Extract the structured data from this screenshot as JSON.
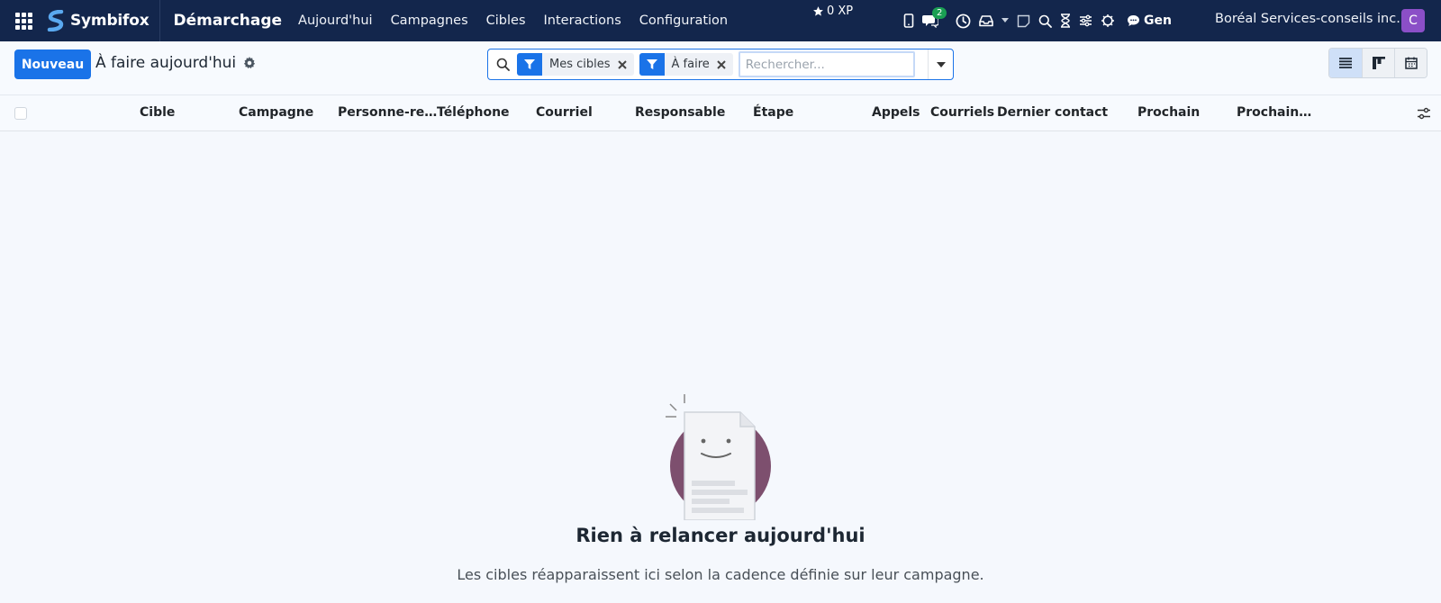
{
  "navbar": {
    "brand": "Symbifox",
    "app_title": "Démarchage",
    "menu": [
      {
        "label": "Aujourd'hui"
      },
      {
        "label": "Campagnes"
      },
      {
        "label": "Cibles"
      },
      {
        "label": "Interactions"
      },
      {
        "label": "Configuration"
      }
    ],
    "xp": "0 XP",
    "chat_badge": "2",
    "gen_label": "Gen",
    "company": "Boréal Services-conseils inc.",
    "avatar_letter": "C",
    "colors": {
      "background": "#13264c",
      "avatar": "#8b4fc7",
      "badge": "#1a9f53"
    }
  },
  "control": {
    "new_label": "Nouveau",
    "view_title": "À faire aujourd'hui",
    "facets": [
      {
        "label": "Mes cibles"
      },
      {
        "label": "À faire"
      }
    ],
    "search_placeholder": "Rechercher...",
    "accent": "#1a73e8"
  },
  "table": {
    "columns": [
      "Cible",
      "Campagne",
      "Personne-re…",
      "Téléphone",
      "Courriel",
      "Responsable",
      "Étape",
      "Appels",
      "Courriels",
      "Dernier contact",
      "Prochain",
      "Prochain…"
    ]
  },
  "empty_state": {
    "title": "Rien à relancer aujourd'hui",
    "text": "Les cibles réapparaissent ici selon la cadence définie sur leur campagne."
  }
}
